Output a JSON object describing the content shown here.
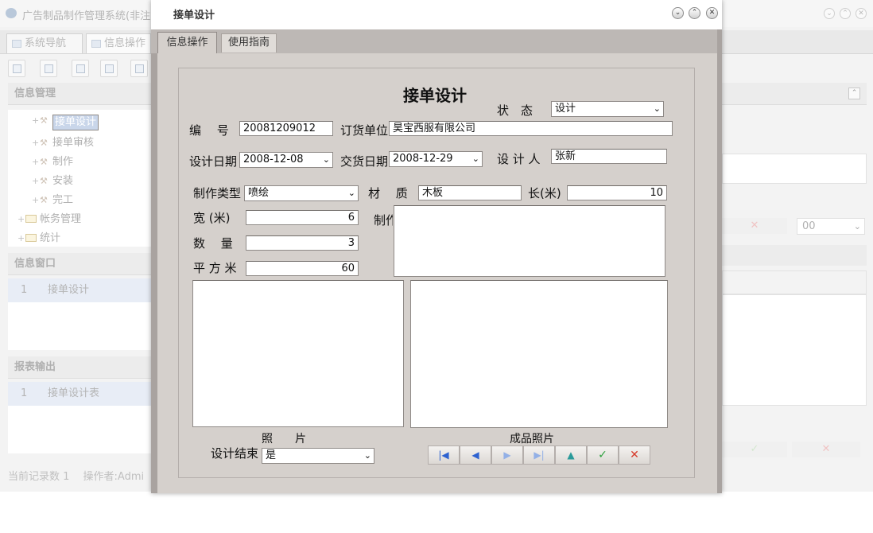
{
  "background": {
    "app_title": "广告制品制作管理系统(非注",
    "tabs": [
      "系统导航",
      "信息操作"
    ],
    "sections": {
      "info_manage": "信息管理",
      "info_window": "信息窗口",
      "report_output": "报表输出"
    },
    "tree": [
      {
        "label": "接单设计",
        "selected": true
      },
      {
        "label": "接单审核"
      },
      {
        "label": "制作"
      },
      {
        "label": "安装"
      },
      {
        "label": "完工"
      },
      {
        "label": "帐务管理",
        "folder": true
      },
      {
        "label": "统计",
        "folder": true
      }
    ],
    "info_window_rows": [
      {
        "num": "1",
        "label": "接单设计"
      }
    ],
    "report_rows": [
      {
        "num": "1",
        "label": "接单设计表"
      }
    ],
    "status_bar": "当前记录数 1　 操作者:Admi",
    "right_select_value": "00"
  },
  "dialog": {
    "title": "接单设计",
    "tabs": {
      "ops": "信息操作",
      "guide": "使用指南"
    },
    "form_title": "接单设计",
    "labels": {
      "status": "状　态",
      "number": "编　 号",
      "order_unit": "订货单位",
      "design_date": "设计日期",
      "delivery_date": "交货日期",
      "designer": "设 计 人",
      "make_type": "制作类型",
      "material": "材　 质",
      "length": "长(米)",
      "width": "宽 (米)",
      "production": "制作",
      "quantity": "数　 量",
      "area": "平 方 米",
      "photo": "照　　片",
      "finished_photo": "成品照片",
      "design_end": "设计结束"
    },
    "values": {
      "status": "设计",
      "number": "20081209012",
      "order_unit": "昊宝西服有限公司",
      "design_date": "2008-12-08",
      "delivery_date": "2008-12-29",
      "designer": "张新",
      "make_type": "喷绘",
      "material": "木板",
      "length": "10",
      "width": "6",
      "quantity": "3",
      "area": "60",
      "design_end": "是"
    },
    "nav_icons": [
      "first-icon",
      "prev-icon",
      "next-icon",
      "last-icon",
      "up-icon",
      "confirm-icon",
      "cancel-icon"
    ]
  }
}
